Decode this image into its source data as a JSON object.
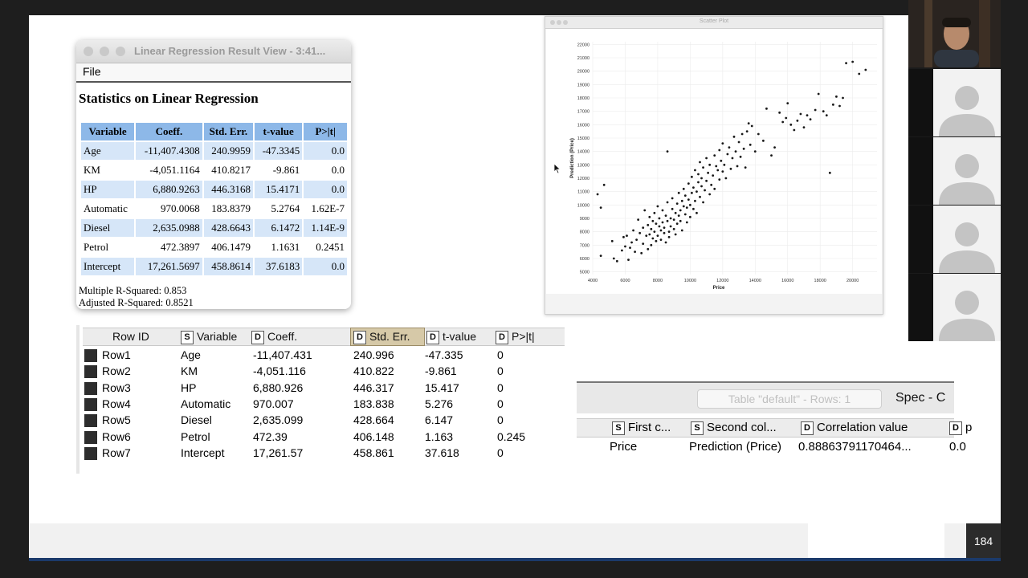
{
  "regression_window": {
    "title": "Linear Regression Result View - 3:41...",
    "menu_file": "File",
    "heading": "Statistics on Linear Regression",
    "columns": [
      "Variable",
      "Coeff.",
      "Std. Err.",
      "t-value",
      "P>|t|"
    ],
    "rows": [
      [
        "Age",
        "-11,407.4308",
        "240.9959",
        "-47.3345",
        "0.0"
      ],
      [
        "KM",
        "-4,051.1164",
        "410.8217",
        "-9.861",
        "0.0"
      ],
      [
        "HP",
        "6,880.9263",
        "446.3168",
        "15.4171",
        "0.0"
      ],
      [
        "Automatic",
        "970.0068",
        "183.8379",
        "5.2764",
        "1.62E-7"
      ],
      [
        "Diesel",
        "2,635.0988",
        "428.6643",
        "6.1472",
        "1.14E-9"
      ],
      [
        "Petrol",
        "472.3897",
        "406.1479",
        "1.1631",
        "0.2451"
      ],
      [
        "Intercept",
        "17,261.5697",
        "458.8614",
        "37.6183",
        "0.0"
      ]
    ],
    "r_squared": "Multiple R-Squared: 0.853",
    "adj_r_squared": "Adjusted R-Squared: 0.8521"
  },
  "scatter_window": {
    "title": "Scatter Plot"
  },
  "chart_data": {
    "type": "scatter",
    "xlabel": "Price",
    "ylabel": "Prediction (Price)",
    "xlim": [
      4000,
      21500
    ],
    "ylim": [
      4800,
      22200
    ],
    "x_ticks": [
      "4000",
      "6000",
      "8000",
      "10000",
      "12000",
      "14000",
      "16000",
      "18000",
      "20000"
    ],
    "y_ticks": [
      "5000",
      "6000",
      "7000",
      "8000",
      "9000",
      "10000",
      "11000",
      "12000",
      "13000",
      "14000",
      "15000",
      "16000",
      "17000",
      "18000",
      "19000",
      "20000",
      "21000",
      "22000"
    ],
    "grid": true,
    "legend": "none",
    "colors": {
      "point": "#1a1a1a",
      "grid": "#ececec"
    },
    "points": [
      [
        4300,
        10800
      ],
      [
        4500,
        9800
      ],
      [
        4700,
        11500
      ],
      [
        4500,
        6200
      ],
      [
        5200,
        7300
      ],
      [
        5300,
        6000
      ],
      [
        5500,
        5800
      ],
      [
        5800,
        6600
      ],
      [
        5900,
        7600
      ],
      [
        6000,
        6900
      ],
      [
        6100,
        7700
      ],
      [
        6200,
        5900
      ],
      [
        6300,
        6800
      ],
      [
        6400,
        7200
      ],
      [
        6500,
        8100
      ],
      [
        6600,
        6500
      ],
      [
        6700,
        7400
      ],
      [
        6800,
        8900
      ],
      [
        6900,
        7900
      ],
      [
        7000,
        6400
      ],
      [
        7100,
        8300
      ],
      [
        7100,
        7100
      ],
      [
        7200,
        9600
      ],
      [
        7300,
        7700
      ],
      [
        7400,
        8500
      ],
      [
        7400,
        6700
      ],
      [
        7500,
        9100
      ],
      [
        7500,
        7800
      ],
      [
        7600,
        8200
      ],
      [
        7600,
        7000
      ],
      [
        7700,
        8800
      ],
      [
        7700,
        7500
      ],
      [
        7800,
        8000
      ],
      [
        7800,
        9400
      ],
      [
        7900,
        7300
      ],
      [
        7900,
        8600
      ],
      [
        8000,
        9900
      ],
      [
        8000,
        7700
      ],
      [
        8100,
        8400
      ],
      [
        8100,
        9000
      ],
      [
        8200,
        7400
      ],
      [
        8200,
        8100
      ],
      [
        8300,
        8700
      ],
      [
        8300,
        9600
      ],
      [
        8400,
        7900
      ],
      [
        8400,
        8300
      ],
      [
        8500,
        7200
      ],
      [
        8500,
        9200
      ],
      [
        8600,
        8800
      ],
      [
        8600,
        10200
      ],
      [
        8700,
        8000
      ],
      [
        8700,
        7600
      ],
      [
        8800,
        9000
      ],
      [
        8800,
        8400
      ],
      [
        8900,
        9700
      ],
      [
        8900,
        10500
      ],
      [
        9000,
        8200
      ],
      [
        9000,
        8900
      ],
      [
        9100,
        9400
      ],
      [
        9100,
        7800
      ],
      [
        9200,
        10100
      ],
      [
        9200,
        8600
      ],
      [
        9300,
        9200
      ],
      [
        9300,
        10900
      ],
      [
        9400,
        8800
      ],
      [
        9400,
        9600
      ],
      [
        9500,
        10300
      ],
      [
        9500,
        8100
      ],
      [
        9600,
        9900
      ],
      [
        9600,
        11200
      ],
      [
        9700,
        9300
      ],
      [
        9700,
        10700
      ],
      [
        9800,
        8700
      ],
      [
        9800,
        9800
      ],
      [
        9900,
        10400
      ],
      [
        9900,
        11600
      ],
      [
        10000,
        9100
      ],
      [
        10000,
        10000
      ],
      [
        10100,
        10900
      ],
      [
        10100,
        12100
      ],
      [
        10200,
        9700
      ],
      [
        10200,
        11300
      ],
      [
        10300,
        10300
      ],
      [
        10300,
        12600
      ],
      [
        10400,
        11000
      ],
      [
        10400,
        9400
      ],
      [
        10500,
        11700
      ],
      [
        10500,
        12300
      ],
      [
        10600,
        10600
      ],
      [
        10600,
        13200
      ],
      [
        10700,
        11400
      ],
      [
        10700,
        12000
      ],
      [
        10800,
        10200
      ],
      [
        10800,
        12800
      ],
      [
        10900,
        11100
      ],
      [
        11000,
        13500
      ],
      [
        11000,
        11800
      ],
      [
        11100,
        12400
      ],
      [
        11200,
        10800
      ],
      [
        11200,
        13000
      ],
      [
        11300,
        11500
      ],
      [
        11400,
        12200
      ],
      [
        11500,
        13700
      ],
      [
        11500,
        11200
      ],
      [
        11600,
        12900
      ],
      [
        11700,
        12600
      ],
      [
        11800,
        14100
      ],
      [
        11800,
        11900
      ],
      [
        11900,
        13300
      ],
      [
        12000,
        12500
      ],
      [
        12000,
        14600
      ],
      [
        12100,
        13000
      ],
      [
        12200,
        12000
      ],
      [
        12300,
        13800
      ],
      [
        12400,
        14300
      ],
      [
        12500,
        12700
      ],
      [
        12600,
        13500
      ],
      [
        12700,
        15100
      ],
      [
        12800,
        14000
      ],
      [
        12900,
        12900
      ],
      [
        13000,
        14700
      ],
      [
        13100,
        13600
      ],
      [
        13200,
        15300
      ],
      [
        13300,
        14200
      ],
      [
        13400,
        12800
      ],
      [
        13500,
        15500
      ],
      [
        13700,
        14500
      ],
      [
        13800,
        15900
      ],
      [
        14000,
        14000
      ],
      [
        14200,
        15300
      ],
      [
        14500,
        14800
      ],
      [
        15000,
        13700
      ],
      [
        15200,
        14300
      ],
      [
        15500,
        16900
      ],
      [
        15700,
        16200
      ],
      [
        15900,
        16500
      ],
      [
        16000,
        17600
      ],
      [
        16200,
        16000
      ],
      [
        16400,
        15600
      ],
      [
        16600,
        16300
      ],
      [
        16800,
        16800
      ],
      [
        17000,
        15800
      ],
      [
        17200,
        16700
      ],
      [
        17400,
        16400
      ],
      [
        17700,
        17100
      ],
      [
        17900,
        18300
      ],
      [
        18200,
        17000
      ],
      [
        18400,
        16700
      ],
      [
        18600,
        12400
      ],
      [
        18800,
        17500
      ],
      [
        19000,
        18100
      ],
      [
        19200,
        17400
      ],
      [
        19400,
        18000
      ],
      [
        19600,
        20600
      ],
      [
        20000,
        20700
      ],
      [
        20400,
        19800
      ],
      [
        20800,
        20100
      ],
      [
        8600,
        14000
      ],
      [
        13600,
        16100
      ],
      [
        14700,
        17200
      ]
    ]
  },
  "knime_table": {
    "columns": [
      {
        "badge": "",
        "label": "Row ID"
      },
      {
        "badge": "S",
        "label": "Variable"
      },
      {
        "badge": "D",
        "label": "Coeff."
      },
      {
        "badge": "D",
        "label": "Std. Err."
      },
      {
        "badge": "D",
        "label": "t-value"
      },
      {
        "badge": "D",
        "label": "P>|t|"
      }
    ],
    "rows": [
      [
        "Row1",
        "Age",
        "-11,407.431",
        "240.996",
        "-47.335",
        "0"
      ],
      [
        "Row2",
        "KM",
        "-4,051.116",
        "410.822",
        "-9.861",
        "0"
      ],
      [
        "Row3",
        "HP",
        "6,880.926",
        "446.317",
        "15.417",
        "0"
      ],
      [
        "Row4",
        "Automatic",
        "970.007",
        "183.838",
        "5.276",
        "0"
      ],
      [
        "Row5",
        "Diesel",
        "2,635.099",
        "428.664",
        "6.147",
        "0"
      ],
      [
        "Row6",
        "Petrol",
        "472.39",
        "406.148",
        "1.163",
        "0.245"
      ],
      [
        "Row7",
        "Intercept",
        "17,261.57",
        "458.861",
        "37.618",
        "0"
      ]
    ]
  },
  "correlation_table": {
    "table_label": "Table \"default\" - Rows: 1",
    "spec_label": "Spec - C",
    "columns": [
      {
        "badge": "S",
        "label": "First c..."
      },
      {
        "badge": "S",
        "label": "Second col..."
      },
      {
        "badge": "D",
        "label": "Correlation value"
      },
      {
        "badge": "D",
        "label": "p"
      }
    ],
    "row": [
      "Price",
      "Prediction (Price)",
      "0.88863791170464...",
      "0.0"
    ]
  },
  "slide": {
    "page_number": "184"
  },
  "video": {
    "participant_tiles": 4
  }
}
